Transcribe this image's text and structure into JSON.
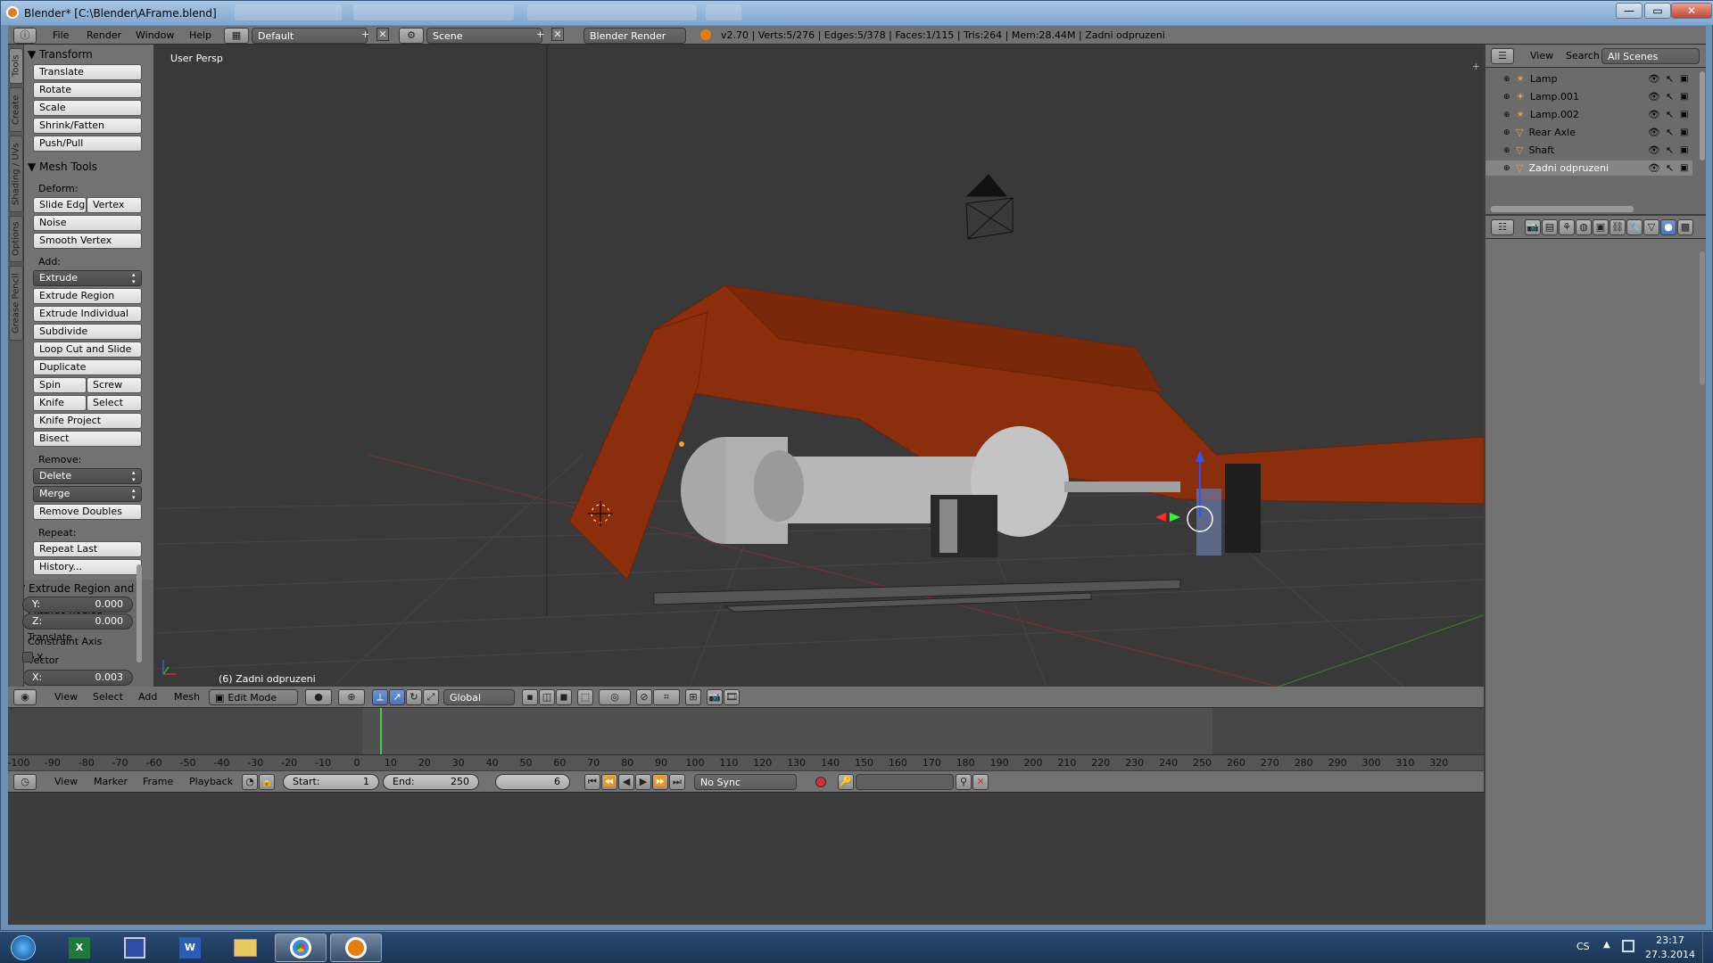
{
  "window": {
    "title": "Blender* [C:\\Blender\\AFrame.blend]",
    "controls": [
      "—",
      "▭",
      "✕"
    ]
  },
  "info_header": {
    "menus": [
      "File",
      "Render",
      "Window",
      "Help"
    ],
    "layout": "Default",
    "scene": "Scene",
    "engine": "Blender Render",
    "stats": "v2.70 | Verts:5/276 | Edges:5/378 | Faces:1/115 | Tris:264 | Mem:28.44M | Zadni odpruzeni"
  },
  "vertical_tabs": [
    "Tools",
    "Create",
    "Shading / UVs",
    "Options",
    "Grease Pencil"
  ],
  "tool_shelf": {
    "transform_title": "Transform",
    "transform_buttons": [
      "Translate",
      "Rotate",
      "Scale",
      "Shrink/Fatten",
      "Push/Pull"
    ],
    "mesh_tools_title": "Mesh Tools",
    "deform_label": "Deform:",
    "slide_edge": "Slide Edg",
    "vertex": "Vertex",
    "noise": "Noise",
    "smooth_vertex": "Smooth Vertex",
    "add_label": "Add:",
    "extrude": "Extrude",
    "extrude_region": "Extrude Region",
    "extrude_individual": "Extrude Individual",
    "subdivide": "Subdivide",
    "loop_cut": "Loop Cut and Slide",
    "duplicate": "Duplicate",
    "spin": "Spin",
    "screw": "Screw",
    "knife": "Knife",
    "select": "Select",
    "knife_project": "Knife Project",
    "bisect": "Bisect",
    "remove_label": "Remove:",
    "delete": "Delete",
    "merge": "Merge",
    "remove_doubles": "Remove Doubles",
    "repeat_label": "Repeat:",
    "repeat_last": "Repeat Last",
    "history": "History...",
    "operator_title": "Extrude Region and",
    "op_extrude_region": "Extrude Region",
    "op_translate": "Translate",
    "vector_label": "Vector",
    "vector": [
      {
        "axis": "X:",
        "value": "0.003"
      },
      {
        "axis": "Y:",
        "value": "0.000"
      },
      {
        "axis": "Z:",
        "value": "0.000"
      }
    ],
    "constraint_label": "Constraint Axis",
    "constraint_x": "X"
  },
  "viewport": {
    "view_label": "User Persp",
    "object_label": "(6) Zadni odpruzeni"
  },
  "view3d_header": {
    "menus": [
      "View",
      "Select",
      "Add",
      "Mesh"
    ],
    "mode": "Edit Mode",
    "orientation": "Global"
  },
  "timeline": {
    "ticks": [
      "-100",
      "-90",
      "-80",
      "-70",
      "-60",
      "-50",
      "-40",
      "-30",
      "-20",
      "-10",
      "0",
      "10",
      "20",
      "30",
      "40",
      "50",
      "60",
      "70",
      "80",
      "90",
      "100",
      "110",
      "120",
      "130",
      "140",
      "150",
      "160",
      "170",
      "180",
      "190",
      "200",
      "210",
      "220",
      "230",
      "240",
      "250",
      "260",
      "270",
      "280",
      "290",
      "300",
      "310",
      "320"
    ],
    "menus": [
      "View",
      "Marker",
      "Frame",
      "Playback"
    ],
    "start_label": "Start:",
    "start": "1",
    "end_label": "End:",
    "end": "250",
    "current": "6",
    "sync": "No Sync"
  },
  "outliner": {
    "menus": [
      "View",
      "Search"
    ],
    "filter": "All Scenes",
    "items": [
      {
        "name": "Lamp",
        "type": "lamp"
      },
      {
        "name": "Lamp.001",
        "type": "lamp"
      },
      {
        "name": "Lamp.002",
        "type": "lamp"
      },
      {
        "name": "Rear Axle",
        "type": "mesh"
      },
      {
        "name": "Shaft",
        "type": "mesh"
      },
      {
        "name": "Zadni odpruzeni",
        "type": "mesh"
      }
    ]
  },
  "taskbar": {
    "apps": [
      "windows-start",
      "excel",
      "save-disk",
      "word",
      "file-explorer",
      "chrome",
      "blender"
    ],
    "lang": "CS",
    "time": "23:17",
    "date": "27.3.2014"
  },
  "colors": {
    "frame_orange": "#8a2e0c",
    "viewport_bg": "#393939",
    "panel_bg": "#727272",
    "accent": "#5680c2",
    "title_bar": "#8fb0d6"
  }
}
